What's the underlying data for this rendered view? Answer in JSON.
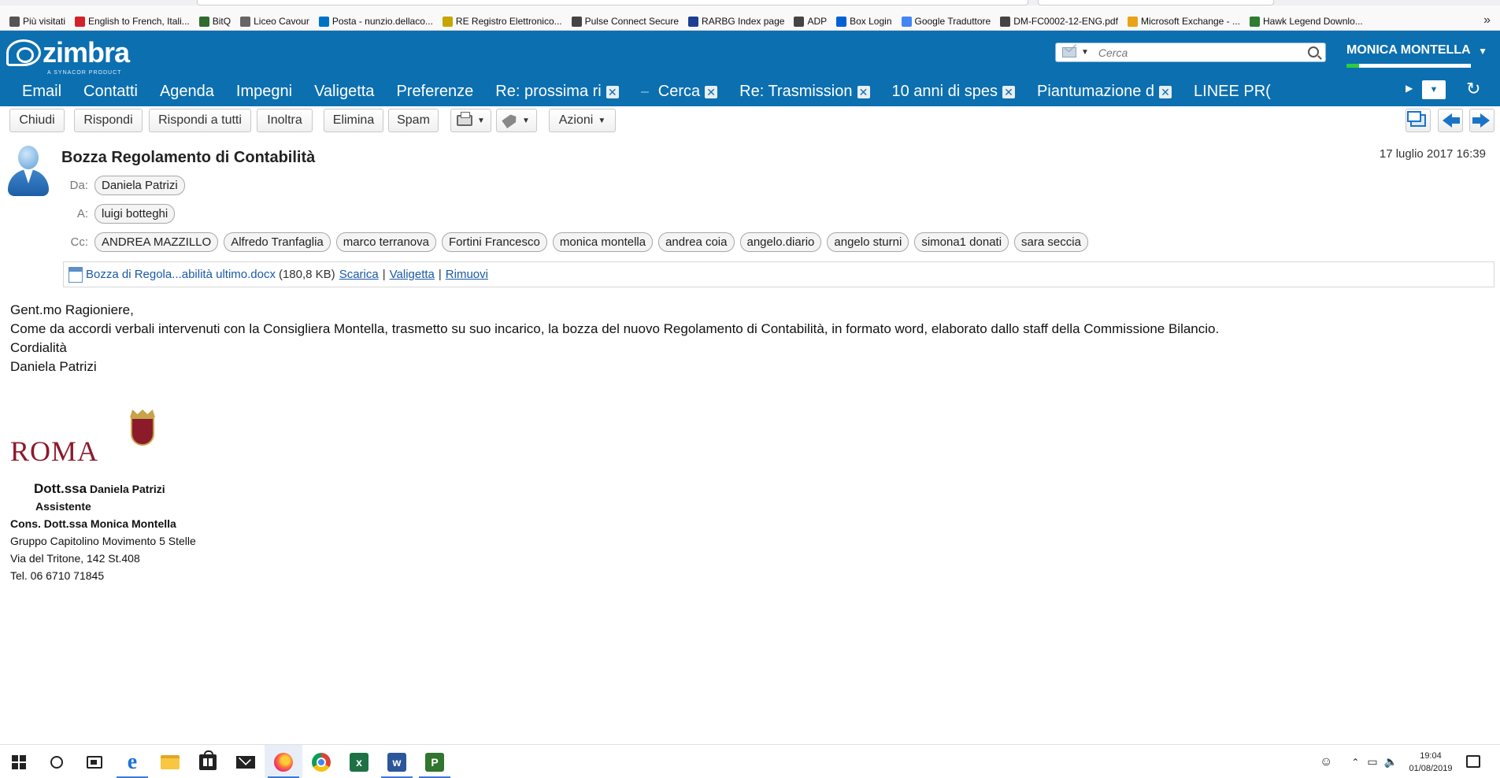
{
  "browser": {
    "bookmarks": [
      {
        "label": "Più visitati",
        "icon": "gear-icon",
        "color": "#555555"
      },
      {
        "label": "English to French, Itali...",
        "icon": "wr-icon",
        "color": "#d2232a"
      },
      {
        "label": "BitQ",
        "icon": "bitq-icon",
        "color": "#2f6b2f"
      },
      {
        "label": "Liceo Cavour",
        "icon": "school-icon",
        "color": "#666666"
      },
      {
        "label": "Posta - nunzio.dellaco...",
        "icon": "outlook-icon",
        "color": "#0072c6"
      },
      {
        "label": "RE Registro Elettronico...",
        "icon": "register-icon",
        "color": "#c8a400"
      },
      {
        "label": "Pulse Connect Secure",
        "icon": "globe-icon",
        "color": "#444444"
      },
      {
        "label": "RARBG Index page",
        "icon": "r-icon",
        "color": "#1c3f94"
      },
      {
        "label": "ADP",
        "icon": "globe-icon",
        "color": "#444444"
      },
      {
        "label": "Box Login",
        "icon": "box-icon",
        "color": "#0061d5"
      },
      {
        "label": "Google Traduttore",
        "icon": "translate-icon",
        "color": "#4285f4"
      },
      {
        "label": "DM-FC0002-12-ENG.pdf",
        "icon": "globe-icon",
        "color": "#444444"
      },
      {
        "label": "Microsoft Exchange - ...",
        "icon": "exchange-icon",
        "color": "#e8a317"
      },
      {
        "label": "Hawk Legend Downlo...",
        "icon": "hawk-icon",
        "color": "#2f7d32"
      }
    ],
    "overflow": "»"
  },
  "zimbra": {
    "logo_text": "zimbra",
    "logo_sub": "A SYNACOR PRODUCT",
    "search_placeholder": "Cerca",
    "user_name": "MONICA MONTELLA",
    "quota_fraction": 0.1,
    "brand_color": "#0c6fb0",
    "app_tabs": [
      "Email",
      "Contatti",
      "Agenda",
      "Impegni",
      "Valigetta",
      "Preferenze"
    ],
    "open_tabs": [
      "Re: prossima ri",
      "Cerca",
      "Re: Trasmission",
      "10 anni di spes",
      "Piantumazione d",
      "LINEE PR("
    ]
  },
  "toolbar": {
    "buttons": [
      "Chiudi",
      "Rispondi",
      "Rispondi a tutti",
      "Inoltra",
      "Elimina",
      "Spam"
    ],
    "actions_label": "Azioni"
  },
  "message": {
    "subject": "Bozza Regolamento di Contabilità",
    "date": "17 luglio 2017 16:39",
    "from_label": "Da:",
    "from": [
      "Daniela Patrizi"
    ],
    "to_label": "A:",
    "to": [
      "luigi botteghi"
    ],
    "cc_label": "Cc:",
    "cc": [
      "ANDREA MAZZILLO",
      "Alfredo Tranfaglia",
      "marco terranova",
      "Fortini Francesco",
      "monica montella",
      "andrea coia",
      "angelo.diario",
      "angelo sturni",
      "simona1 donati",
      "sara seccia"
    ],
    "attachment": {
      "name": "Bozza di Regola...abilità ultimo.docx",
      "size": "(180,8 KB)",
      "download": "Scarica",
      "briefcase": "Valigetta",
      "remove": "Rimuovi",
      "sep": "|"
    },
    "body_lines": [
      "Gent.mo Ragioniere,",
      "Come da accordi verbali intervenuti con la  Consigliera Montella,  trasmetto su suo incarico, la bozza del nuovo  Regolamento di Contabilità, in formato word, elaborato dallo staff della Commissione Bilancio.",
      "Cordialità",
      "Daniela Patrizi"
    ],
    "signature": {
      "logo_text": "ROMA",
      "title_prefix": "Dott.ssa",
      "name": "Daniela Patrizi",
      "role": "Assistente",
      "for": "Cons. Dott.ssa Monica Montella",
      "group": "Gruppo Capitolino Movimento 5 Stelle",
      "address": "Via del Tritone, 142 St.408",
      "phone": "Tel. 06 6710 71845"
    }
  },
  "taskbar": {
    "time": "19:04",
    "date": "01/08/2019"
  }
}
